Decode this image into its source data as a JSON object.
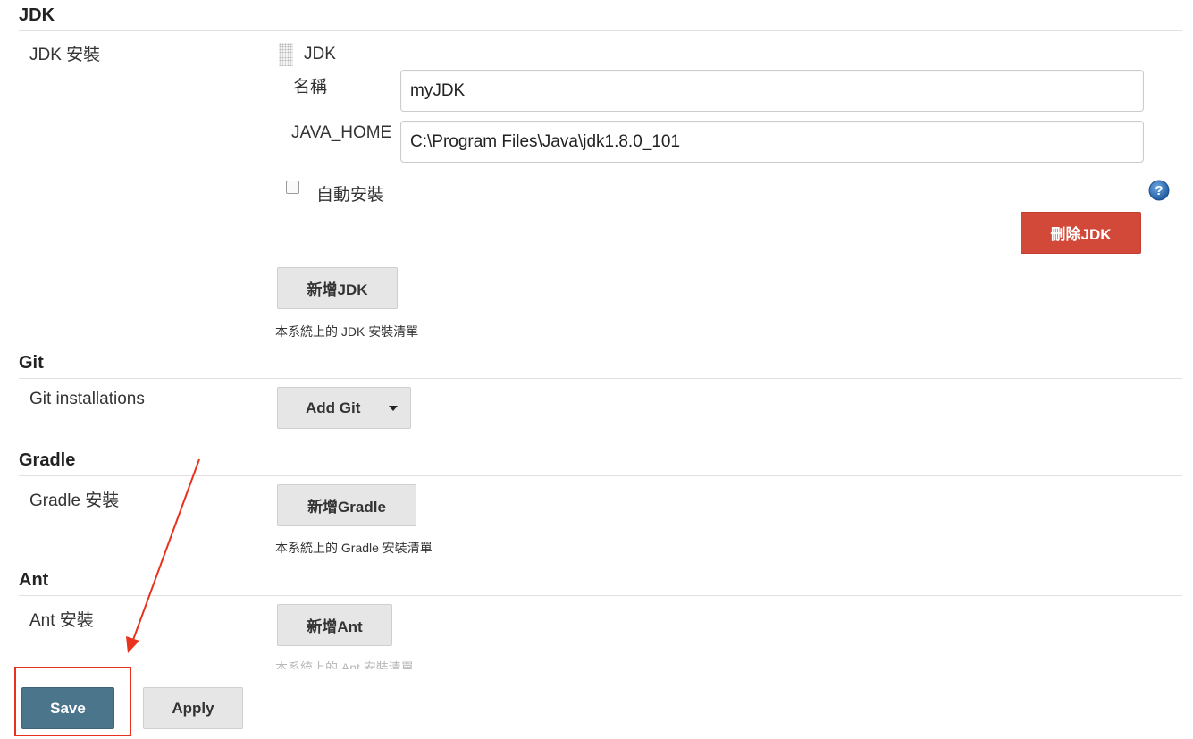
{
  "jdk": {
    "title": "JDK",
    "row_label": "JDK 安裝",
    "item_header": "JDK",
    "name_label": "名稱",
    "name_value": "myJDK",
    "java_home_label": "JAVA_HOME",
    "java_home_value": "C:\\Program Files\\Java\\jdk1.8.0_101",
    "auto_install_label": "自動安裝",
    "delete_button": "刪除JDK",
    "add_button": "新增JDK",
    "help": "本系統上的 JDK 安裝清單"
  },
  "git": {
    "title": "Git",
    "row_label": "Git installations",
    "add_button": "Add Git"
  },
  "gradle": {
    "title": "Gradle",
    "row_label": "Gradle 安裝",
    "add_button": "新增Gradle",
    "help": "本系統上的 Gradle 安裝清單"
  },
  "ant": {
    "title": "Ant",
    "row_label": "Ant 安裝",
    "add_button": "新增Ant",
    "help": "本系統上的 Ant 安裝清單"
  },
  "footer": {
    "save_button": "Save",
    "apply_button": "Apply"
  },
  "colors": {
    "save": "#4b758b",
    "delete": "#d24939",
    "annotation": "#e8321e",
    "help_icon": "#2f6fb5"
  }
}
